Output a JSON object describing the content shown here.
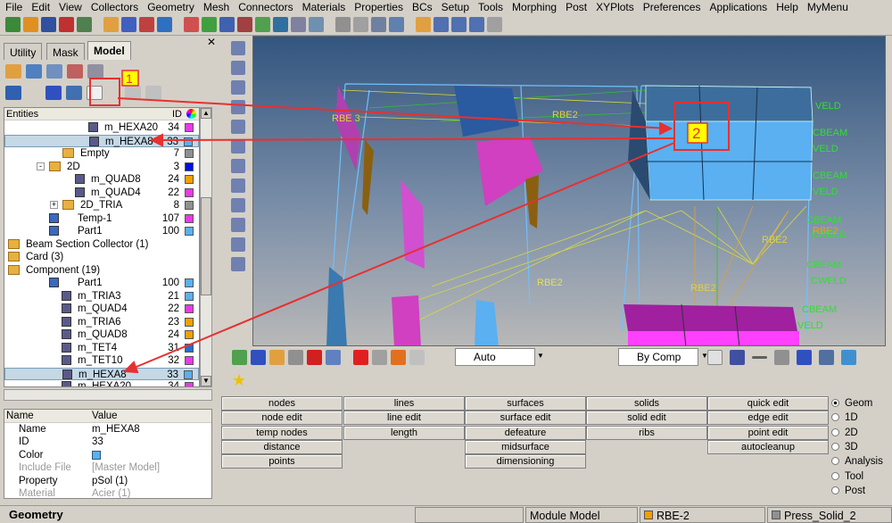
{
  "menu": [
    "File",
    "Edit",
    "View",
    "Collectors",
    "Geometry",
    "Mesh",
    "Connectors",
    "Materials",
    "Properties",
    "BCs",
    "Setup",
    "Tools",
    "Morphing",
    "Post",
    "XYPlots",
    "Preferences",
    "Applications",
    "Help",
    "MyMenu"
  ],
  "tabs": [
    "Utility",
    "Mask",
    "Model"
  ],
  "tree": {
    "header_entities": "Entities",
    "header_id": "ID",
    "rows": [
      {
        "name": "m_HEXA20",
        "id": "34",
        "color": "#e83ae8",
        "level": 4,
        "type": "comp"
      },
      {
        "name": "m_HEXA8",
        "id": "33",
        "color": "#5ab0f0",
        "level": 4,
        "type": "comp",
        "selected": true
      },
      {
        "name": "Empty",
        "id": "7",
        "color": "#909090",
        "level": 3,
        "type": "asm"
      },
      {
        "name": "2D",
        "id": "3",
        "color": "#0010e0",
        "level": 2,
        "type": "asm",
        "expand": "-"
      },
      {
        "name": "m_QUAD8",
        "id": "24",
        "color": "#f0a000",
        "level": 3,
        "type": "comp"
      },
      {
        "name": "m_QUAD4",
        "id": "22",
        "color": "#e83ae8",
        "level": 3,
        "type": "comp"
      },
      {
        "name": "2D_TRIA",
        "id": "8",
        "color": "#909090",
        "level": 3,
        "type": "asm",
        "expand": "+"
      },
      {
        "name": "Temp-1",
        "id": "107",
        "color": "#e83ae8",
        "level": 2,
        "type": "part"
      },
      {
        "name": "Part1",
        "id": "100",
        "color": "#5ab0f0",
        "level": 2,
        "type": "part"
      },
      {
        "name": "Beam Section Collector (1)",
        "level": 0,
        "type": "folder",
        "expand": "+"
      },
      {
        "name": "Card (3)",
        "level": 0,
        "type": "folder",
        "expand": "+"
      },
      {
        "name": "Component (19)",
        "level": 0,
        "type": "folder",
        "expand": "-"
      },
      {
        "name": "Part1",
        "id": "100",
        "color": "#5ab0f0",
        "level": 2,
        "type": "part"
      },
      {
        "name": "m_TRIA3",
        "id": "21",
        "color": "#5ab0f0",
        "level": 2,
        "type": "comp"
      },
      {
        "name": "m_QUAD4",
        "id": "22",
        "color": "#e83ae8",
        "level": 2,
        "type": "comp"
      },
      {
        "name": "m_TRIA6",
        "id": "23",
        "color": "#f0a000",
        "level": 2,
        "type": "comp"
      },
      {
        "name": "m_QUAD8",
        "id": "24",
        "color": "#f0a000",
        "level": 2,
        "type": "comp"
      },
      {
        "name": "m_TET4",
        "id": "31",
        "color": "#2a6ad0",
        "level": 2,
        "type": "comp"
      },
      {
        "name": "m_TET10",
        "id": "32",
        "color": "#e83ae8",
        "level": 2,
        "type": "comp"
      },
      {
        "name": "m_HEXA8",
        "id": "33",
        "color": "#5ab0f0",
        "level": 2,
        "type": "comp",
        "selected": true
      },
      {
        "name": "m_HEXA20",
        "id": "34",
        "color": "#e83ae8",
        "level": 2,
        "type": "comp"
      }
    ]
  },
  "props": {
    "header_name": "Name",
    "header_value": "Value",
    "rows": [
      {
        "name": "Name",
        "value": "m_HEXA8"
      },
      {
        "name": "ID",
        "value": "33"
      },
      {
        "name": "Color",
        "value": "",
        "swatch": "#5ab0f0"
      },
      {
        "name": "Include File",
        "value": "[Master Model]",
        "dim": true
      },
      {
        "name": "Property",
        "value": "pSol (1)"
      },
      {
        "name": "Material",
        "value": "Acier (1)",
        "dim": true
      }
    ]
  },
  "toolbar2": {
    "display_mode": "Auto",
    "color_mode": "By Comp"
  },
  "panel": {
    "columns": [
      [
        "nodes",
        "node edit",
        "temp nodes",
        "distance",
        "points"
      ],
      [
        "lines",
        "line edit",
        "length"
      ],
      [
        "surfaces",
        "surface edit",
        "defeature",
        "midsurface",
        "dimensioning"
      ],
      [
        "solids",
        "solid edit",
        "ribs"
      ],
      [
        "quick edit",
        "edge edit",
        "point edit",
        "autocleanup"
      ]
    ],
    "radios": [
      {
        "label": "Geom",
        "on": true
      },
      {
        "label": "1D"
      },
      {
        "label": "2D"
      },
      {
        "label": "3D"
      },
      {
        "label": "Analysis"
      },
      {
        "label": "Tool"
      },
      {
        "label": "Post"
      }
    ]
  },
  "viewport_labels": {
    "green": [
      "VELD",
      "CBEAM",
      "VELD",
      "CBEAM",
      "VELD",
      "CBEAM",
      "CWELD",
      "CBEAM",
      "CWELD",
      "CBEAM",
      "VELD",
      "RBE2"
    ],
    "yellow": [
      "RBE2",
      "RBE2",
      "RBE2",
      "RBE2",
      "RBE 3"
    ]
  },
  "annotations": [
    "1",
    "2"
  ],
  "status": {
    "left": "Geometry",
    "module": "Module Model",
    "collector": "RBE-2",
    "component": "Press_Solid_2",
    "collector_color": "#f0a000",
    "component_color": "#909090"
  },
  "colors": {
    "accent_red": "#e83030",
    "highlight_yellow": "#ffff00",
    "hexa_blue": "#5ab0f0",
    "magenta": "#e83ae8"
  }
}
